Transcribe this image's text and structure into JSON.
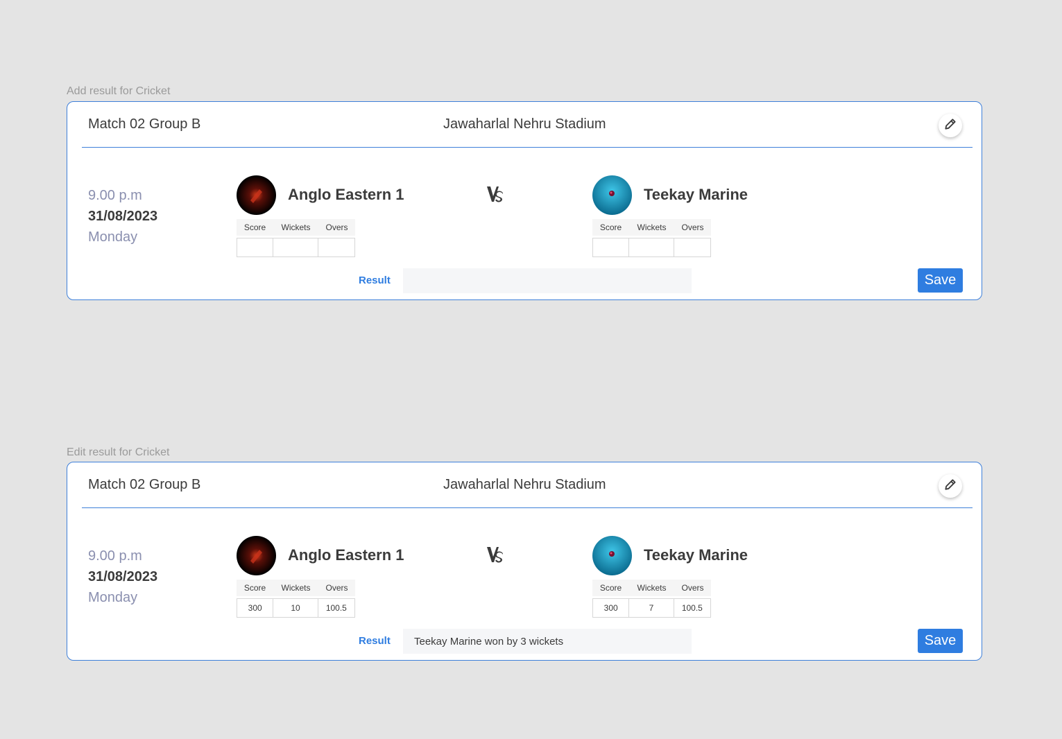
{
  "cards": [
    {
      "section_label": "Add result for Cricket",
      "match_name": "Match 02 Group B",
      "venue": "Jawaharlal Nehru Stadium",
      "time": "9.00 p.m",
      "date": "31/08/2023",
      "day": "Monday",
      "vs_label": "VS",
      "team1": {
        "name": "Anglo Eastern 1",
        "score": "",
        "wickets": "",
        "overs": ""
      },
      "team2": {
        "name": "Teekay Marine",
        "score": "",
        "wickets": "",
        "overs": ""
      },
      "stat_headers": {
        "score": "Score",
        "wickets": "Wickets",
        "overs": "Overs"
      },
      "result_label": "Result",
      "result_value": "",
      "save_label": "Save"
    },
    {
      "section_label": "Edit result for Cricket",
      "match_name": "Match 02 Group B",
      "venue": "Jawaharlal Nehru Stadium",
      "time": "9.00 p.m",
      "date": "31/08/2023",
      "day": "Monday",
      "vs_label": "VS",
      "team1": {
        "name": "Anglo Eastern 1",
        "score": "300",
        "wickets": "10",
        "overs": "100.5"
      },
      "team2": {
        "name": "Teekay Marine",
        "score": "300",
        "wickets": "7",
        "overs": "100.5"
      },
      "stat_headers": {
        "score": "Score",
        "wickets": "Wickets",
        "overs": "Overs"
      },
      "result_label": "Result",
      "result_value": "Teekay Marine won by 3 wickets",
      "save_label": "Save"
    }
  ],
  "icons": {
    "edit": "pencil-icon",
    "team1_logo": "anglo-eastern-logo",
    "team2_logo": "teekay-marine-logo"
  },
  "colors": {
    "accent": "#2f7de0",
    "border": "#3d7fd9",
    "muted_text": "#8a8faf",
    "background": "#e4e4e4"
  }
}
